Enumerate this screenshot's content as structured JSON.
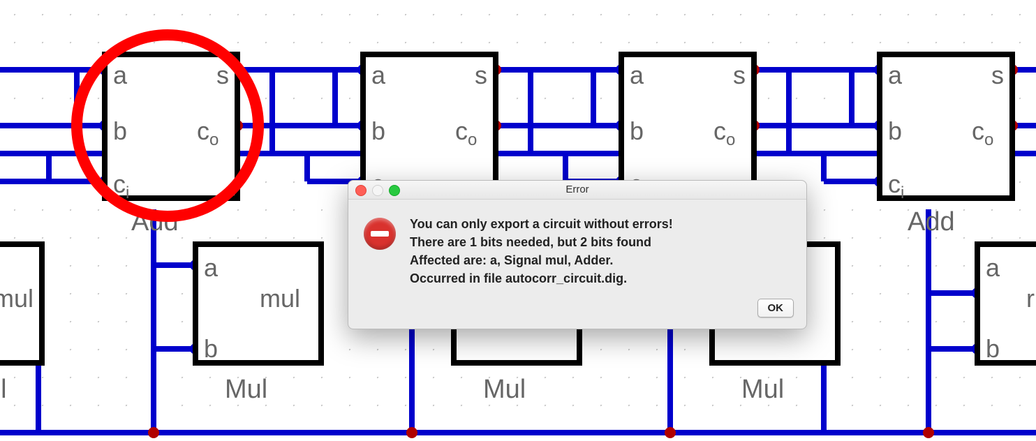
{
  "dialog": {
    "title": "Error",
    "line1": "You can only export a circuit without errors!",
    "line2": "There are 1 bits needed, but 2 bits found",
    "line3": "Affected are: a, Signal mul, Adder.",
    "line4": "Occurred in file autocorr_circuit.dig.",
    "ok_label": "OK"
  },
  "circuit": {
    "adder_ports": {
      "a": "a",
      "b": "b",
      "ci": "c",
      "ci_sub": "i",
      "s": "s",
      "co": "c",
      "co_sub": "o"
    },
    "mul_ports": {
      "a": "a",
      "b": "b",
      "mul": "mul"
    },
    "add_label": "Add",
    "mul_label": "Mul",
    "ul_label": "ul",
    "highlight_color": "#ff0000",
    "wire_color": "#0000cc",
    "node_color": "#b00000",
    "block_stroke": "#000000"
  }
}
